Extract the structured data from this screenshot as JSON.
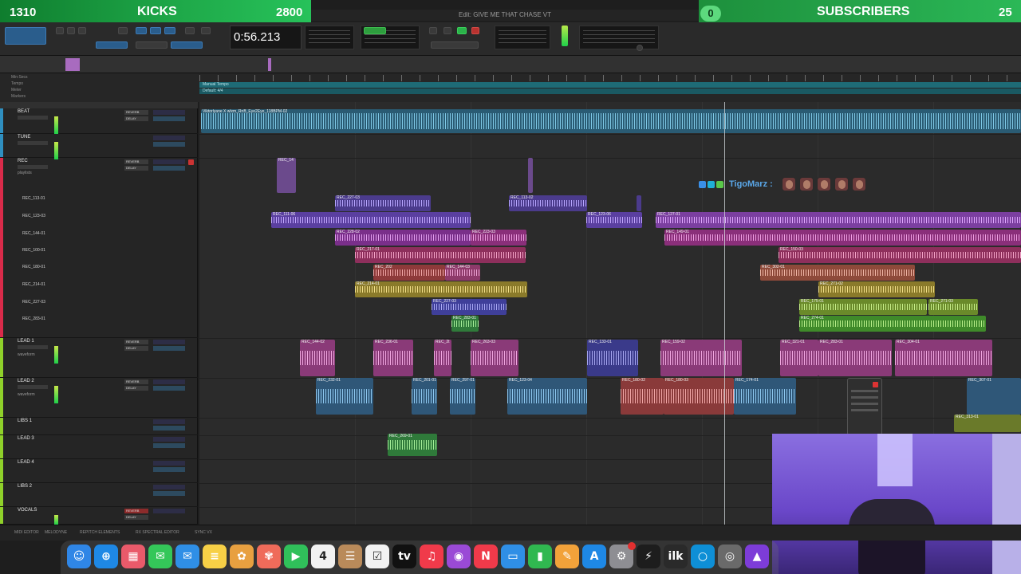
{
  "overlay": {
    "left_count": "1310",
    "left_title": "KICKS",
    "left_value": "2800",
    "right_pill": "0",
    "right_title": "SUBSCRIBERS",
    "right_value": "25"
  },
  "window": {
    "title": "Edit: GIVE ME THAT CHASE VT"
  },
  "transport": {
    "counter": "0:56.213"
  },
  "rulers": {
    "labels": [
      "Min:Secs",
      "Tempo",
      "Meter",
      "Markers"
    ],
    "tempo_text": "Manual Tempo",
    "meter_text": "Default: 4/4"
  },
  "tracks": [
    {
      "name": "BEAT",
      "color": "#2f8fc0",
      "insert1": "REVERB",
      "insert2": "DELAY"
    },
    {
      "name": "TUNE",
      "color": "#2f8fc0"
    },
    {
      "name": "REC",
      "color": "#d92b4a",
      "insert1": "REVERB",
      "insert2": "DELAY",
      "sub": "playlists"
    },
    {
      "name": "LEAD 1",
      "color": "#8fd12a",
      "insert1": "REVERB",
      "insert2": "DELAY",
      "sub": "waveform"
    },
    {
      "name": "LEAD 2",
      "color": "#8fd12a",
      "insert1": "REVERB",
      "insert2": "DELAY",
      "sub": "waveform"
    },
    {
      "name": "LIBS 1",
      "color": "#8fd12a"
    },
    {
      "name": "LEAD 3",
      "color": "#8fd12a"
    },
    {
      "name": "LEAD 4",
      "color": "#8fd12a"
    },
    {
      "name": "LIBS 2",
      "color": "#8fd12a"
    },
    {
      "name": "VOCALS",
      "color": "#8fd12a",
      "insert1": "REVERB",
      "insert2": "DELAY"
    }
  ],
  "rec_playlists": [
    "REC_113-01",
    "REC_123-03",
    "REC_144-01",
    "REC_100-01",
    "REC_180-01",
    "REC_214-01",
    "REC_227-03",
    "REC_283-01"
  ],
  "clips": {
    "beat": "Viktorlyane X wlxm_RnB_Eye2Eye_118BPM-02",
    "rec_top": "REC_14",
    "rec_a": "REC_227-03",
    "rec_b": "REC_113-02",
    "rec_c": "REC_111-06",
    "rec_d": "REC_123-06",
    "rec_e": "REC_127-01",
    "rec_f": "REC_228-02",
    "rec_g": "REC_223-03",
    "rec_h": "REC_149-01",
    "rec_i": "REC_217-01",
    "rec_j": "REC_150-03",
    "rec_k": "REC_202",
    "rec_l": "REC_144-03",
    "rec_m": "REC_302-01",
    "rec_n": "REC_214-01",
    "rec_o": "REC_271-02",
    "rec_p": "REC_227-03",
    "rec_q": "REC_175-01",
    "rec_r": "REC_271-03",
    "rec_s": "REC_283-01",
    "rec_t": "REC_274-01",
    "lead1_a": "REC_144-02",
    "lead1_b": "REC_236-01",
    "lead1_c": "REC_2t",
    "lead1_d": "REC_263-03",
    "lead1_e": "REC_133-01",
    "lead1_f": "REC_159-02",
    "lead1_g": "REC_321-01",
    "lead1_h": "REC_283-01",
    "lead1_i": "REC_304-01",
    "lead2_a": "REC_232-01",
    "lead2_b": "REC_201-01",
    "lead2_c": "REC_297-01",
    "lead2_d": "REC_123-04",
    "lead2_e": "REC_180-02",
    "lead2_f": "REC_180-03",
    "lead2_g": "REC_174-01",
    "lead2_h": "REC_307-01",
    "lead2_i": "REC_313-01",
    "libs_a": "REC_269-01"
  },
  "chat": {
    "user": "TigoMarz :"
  },
  "bottom_bar": [
    "MIDI EDITOR",
    "MELODYNE",
    "REPITCH ELEMENTS",
    "RX SPECTRAL EDITOR",
    "SYNC VX"
  ],
  "dock": [
    {
      "name": "finder-icon",
      "color": "#2f86e6",
      "glyph": "☺"
    },
    {
      "name": "safari-icon",
      "color": "#1e88e5",
      "glyph": "⊕"
    },
    {
      "name": "launchpad-icon",
      "color": "#e95a6a",
      "glyph": "▦"
    },
    {
      "name": "messages-icon",
      "color": "#34c759",
      "glyph": "✉"
    },
    {
      "name": "mail-icon",
      "color": "#2f8fe6",
      "glyph": "✉"
    },
    {
      "name": "notes-icon",
      "color": "#f7d046",
      "glyph": "≡"
    },
    {
      "name": "photos-icon",
      "color": "#e8a040",
      "glyph": "✿"
    },
    {
      "name": "photos-icon-2",
      "color": "#ef6b5a",
      "glyph": "✾"
    },
    {
      "name": "facetime-icon",
      "color": "#30c05a",
      "glyph": "▶"
    },
    {
      "name": "calendar-icon",
      "color": "#f2f2f2",
      "glyph": "4"
    },
    {
      "name": "contacts-icon",
      "color": "#b98a5a",
      "glyph": "☰"
    },
    {
      "name": "reminders-icon",
      "color": "#f2f2f2",
      "glyph": "☑"
    },
    {
      "name": "appletv-icon",
      "color": "#111111",
      "glyph": "tv"
    },
    {
      "name": "music-icon",
      "color": "#f03a4a",
      "glyph": "♫"
    },
    {
      "name": "podcasts-icon",
      "color": "#9a4ad6",
      "glyph": "◉"
    },
    {
      "name": "news-icon",
      "color": "#f03a4a",
      "glyph": "N"
    },
    {
      "name": "keynote-icon",
      "color": "#2f8fe6",
      "glyph": "▭"
    },
    {
      "name": "numbers-icon",
      "color": "#30b850",
      "glyph": "▮"
    },
    {
      "name": "pages-icon",
      "color": "#f2a23a",
      "glyph": "✎"
    },
    {
      "name": "appstore-icon",
      "color": "#1e88e5",
      "glyph": "A"
    },
    {
      "name": "settings-icon",
      "color": "#8e8e93",
      "glyph": "⚙"
    },
    {
      "name": "plugin-icon",
      "color": "#1d1d1d",
      "glyph": "⚡"
    },
    {
      "name": "ilok-icon",
      "color": "#2a2a2a",
      "glyph": "ilk"
    },
    {
      "name": "circle-app-icon",
      "color": "#0e8fd6",
      "glyph": "○"
    },
    {
      "name": "disk-utility-icon",
      "color": "#6a6a6a",
      "glyph": "◎"
    },
    {
      "name": "protools-icon",
      "color": "#7d3cd8",
      "glyph": "▲"
    }
  ],
  "dock_calendar_label": "4"
}
